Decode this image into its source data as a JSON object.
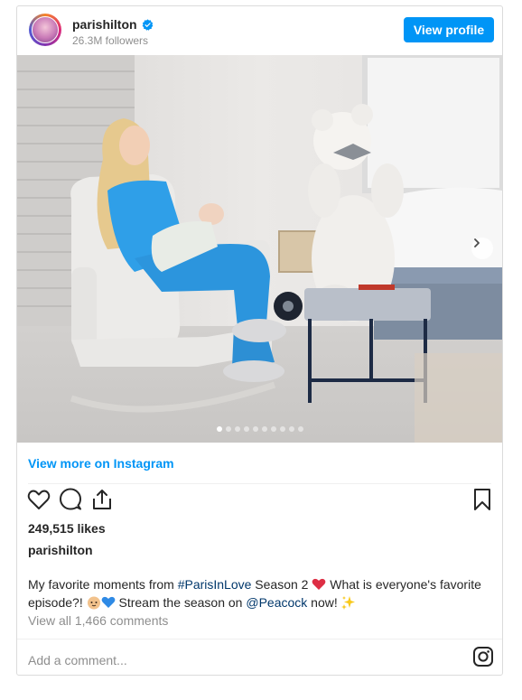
{
  "header": {
    "username": "parishilton",
    "followers": "26.3M followers",
    "view_profile": "View profile"
  },
  "carousel": {
    "slide_count": 10,
    "active_index": 0
  },
  "view_more": "View more on Instagram",
  "likes": "249,515 likes",
  "poster": "parishilton",
  "caption": {
    "part1": "My favorite moments from ",
    "hashtag": "#ParisInLove",
    "part2": " Season 2 ",
    "part3": " What is everyone's favorite episode?! ",
    "part4": " Stream the season on ",
    "mention": "@Peacock",
    "part5": " now! "
  },
  "comments_link": "View all 1,466 comments",
  "add_comment_placeholder": "Add a comment...",
  "colors": {
    "accent": "#0095f6",
    "link": "#00376b",
    "muted": "#8e8e8e"
  },
  "icons": [
    "verified-badge-icon",
    "heart-icon",
    "comment-icon",
    "share-icon",
    "bookmark-icon",
    "chevron-right-icon",
    "instagram-icon"
  ]
}
